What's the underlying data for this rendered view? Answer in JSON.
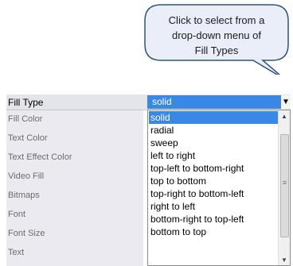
{
  "callout": {
    "text": "Click to select from a\ndrop-down menu of\nFill Types"
  },
  "grid": {
    "header": {
      "name": "Fill Type",
      "value": "solid"
    },
    "rows": [
      "Fill Color",
      "Text Color",
      "Text Effect Color",
      "Video Fill",
      "Bitmaps",
      "Font",
      "Font Size",
      "Text"
    ]
  },
  "dropdown": {
    "selected": "solid",
    "options": [
      "solid",
      "radial",
      "sweep",
      "left to right",
      "top-left to bottom-right",
      "top to bottom",
      "top-right to bottom-left",
      "right to left",
      "bottom-right to top-left",
      "bottom to top"
    ]
  },
  "icons": {
    "dropdown_arrow": "caret-down-icon",
    "scroll_up": "scroll-up-icon",
    "scroll_down": "scroll-down-icon"
  },
  "colors": {
    "selection": "#3a88e6",
    "callout_fill": "#e9eef9",
    "callout_border": "#2f5377"
  }
}
